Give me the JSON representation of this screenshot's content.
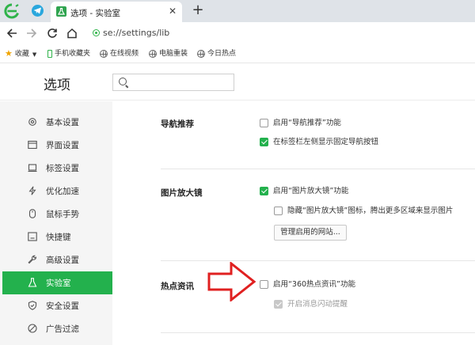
{
  "tabs": [
    {
      "title": "选项 - 实验室",
      "active": true
    }
  ],
  "address_bar": {
    "url": "se://settings/lib"
  },
  "bookmarks": [
    {
      "label": "收藏",
      "icon": "star-icon"
    },
    {
      "label": "手机收藏夹",
      "icon": "phone-icon"
    },
    {
      "label": "在线视频",
      "icon": "globe-icon"
    },
    {
      "label": "电脑重装",
      "icon": "globe-icon"
    },
    {
      "label": "今日热点",
      "icon": "globe-icon"
    }
  ],
  "settings": {
    "title": "选项",
    "search_placeholder": ""
  },
  "sidebar": {
    "items": [
      {
        "label": "基本设置",
        "icon": "gear-icon"
      },
      {
        "label": "界面设置",
        "icon": "window-icon"
      },
      {
        "label": "标签设置",
        "icon": "tab-icon"
      },
      {
        "label": "优化加速",
        "icon": "lightning-icon"
      },
      {
        "label": "鼠标手势",
        "icon": "mouse-icon"
      },
      {
        "label": "快捷键",
        "icon": "keyboard-icon"
      },
      {
        "label": "高级设置",
        "icon": "wrench-icon"
      },
      {
        "label": "实验室",
        "icon": "flask-icon",
        "active": true
      },
      {
        "label": "安全设置",
        "icon": "shield-icon"
      },
      {
        "label": "广告过滤",
        "icon": "block-icon"
      }
    ]
  },
  "sections": {
    "nav": {
      "title": "导航推荐",
      "options": [
        {
          "label": "启用“导航推荐”功能",
          "checked": false
        },
        {
          "label": "在标签栏左侧显示固定导航按钮",
          "checked": true
        }
      ]
    },
    "magnifier": {
      "title": "图片放大镜",
      "options": [
        {
          "label": "启用“图片放大镜”功能",
          "checked": true
        },
        {
          "label": "隐藏“图片放大镜”图标，腾出更多区域来显示图片",
          "checked": false
        }
      ],
      "button_label": "管理启用的网站..."
    },
    "hotnews": {
      "title": "热点资讯",
      "options": [
        {
          "label": "启用“360热点资讯”功能",
          "checked": false
        },
        {
          "label": "开启消息闪动提醒",
          "checked": true,
          "disabled": true
        }
      ]
    }
  },
  "colors": {
    "accent": "#23b14d",
    "annotation_arrow": "#e02020"
  }
}
